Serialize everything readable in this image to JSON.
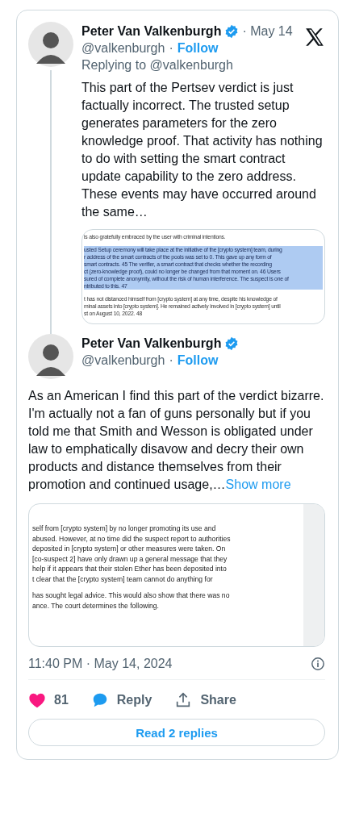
{
  "tweets": [
    {
      "author": "Peter Van Valkenburgh",
      "verified": true,
      "date": "· May 14",
      "handle": "@valkenburgh",
      "separator": "·",
      "follow": "Follow",
      "replying_to": "Replying to @valkenburgh",
      "text": "This part of the Pertsev verdict is just factually incorrect. The trusted setup generates parameters for the zero knowledge proof. That activity has nothing to do with setting the smart contract update capability to the zero address. These events may have occurred around the same…",
      "document": {
        "paragraphs": [
          [
            {
              "text": "is also gratefully embraced by the user with criminal intentions.",
              "highlighted": false
            }
          ],
          [
            {
              "text": "usted Setup ceremony will take place at the initiative of the [crypto system] team, during",
              "highlighted": true
            },
            {
              "text": "r address of the smart contracts of the pools was set to 0. This gave up any form of",
              "highlighted": true
            },
            {
              "text": "smart contracts. 45 The verifier, a smart contract that checks whether the recording",
              "highlighted": true
            },
            {
              "text": "ct (zero-knowledge proof), could no longer be changed from that moment on. 46 Users",
              "highlighted": true
            },
            {
              "text": "sured of complete anonymity, without the risk of human interference. The suspect is one of",
              "highlighted": true
            },
            {
              "text": "ntributed to this. 47",
              "highlighted": true
            }
          ],
          [
            {
              "text": "t has not distanced himself from [crypto system] at any time, despite his knowledge of",
              "highlighted": false
            },
            {
              "text": "minal assets into [crypto system]. He remained actively involved in [crypto system] until",
              "highlighted": false
            },
            {
              "text": "st on August 10, 2022. 48",
              "highlighted": false
            }
          ]
        ]
      }
    },
    {
      "author": "Peter Van Valkenburgh",
      "verified": true,
      "handle": "@valkenburgh",
      "separator": "·",
      "follow": "Follow",
      "text": "As an American I find this part of the verdict bizarre. I'm actually not a fan of guns personally but if you told me that Smith and Wesson is obligated under law to emphatically disavow and decry their own products and distance themselves from their promotion and continued usage,…",
      "show_more": "Show more",
      "document": {
        "paragraphs": [
          [
            {
              "text": "self from [crypto system] by no longer promoting its use and",
              "highlighted": false
            },
            {
              "text": "abused. However, at no time did the suspect report to authorities",
              "highlighted": false
            },
            {
              "text": "deposited in [crypto system] or other measures were taken. On",
              "highlighted": false
            },
            {
              "text": "[co-suspect 2] have only drawn up a general message that they",
              "highlighted": false
            },
            {
              "text": "help if it appears that their stolen Ether has been deposited into",
              "highlighted": false
            },
            {
              "text": "t clear that the [crypto system] team cannot do anything for",
              "highlighted": false
            }
          ],
          [
            {
              "text": "has sought legal advice. This would also show that there was no",
              "highlighted": false
            },
            {
              "text": "ance. The court determines the following.",
              "highlighted": false
            }
          ]
        ]
      }
    }
  ],
  "timestamp": "11:40 PM · May 14, 2024",
  "actions": {
    "likes": "81",
    "liked": true,
    "reply": "Reply",
    "share": "Share"
  },
  "read_replies": "Read 2 replies"
}
